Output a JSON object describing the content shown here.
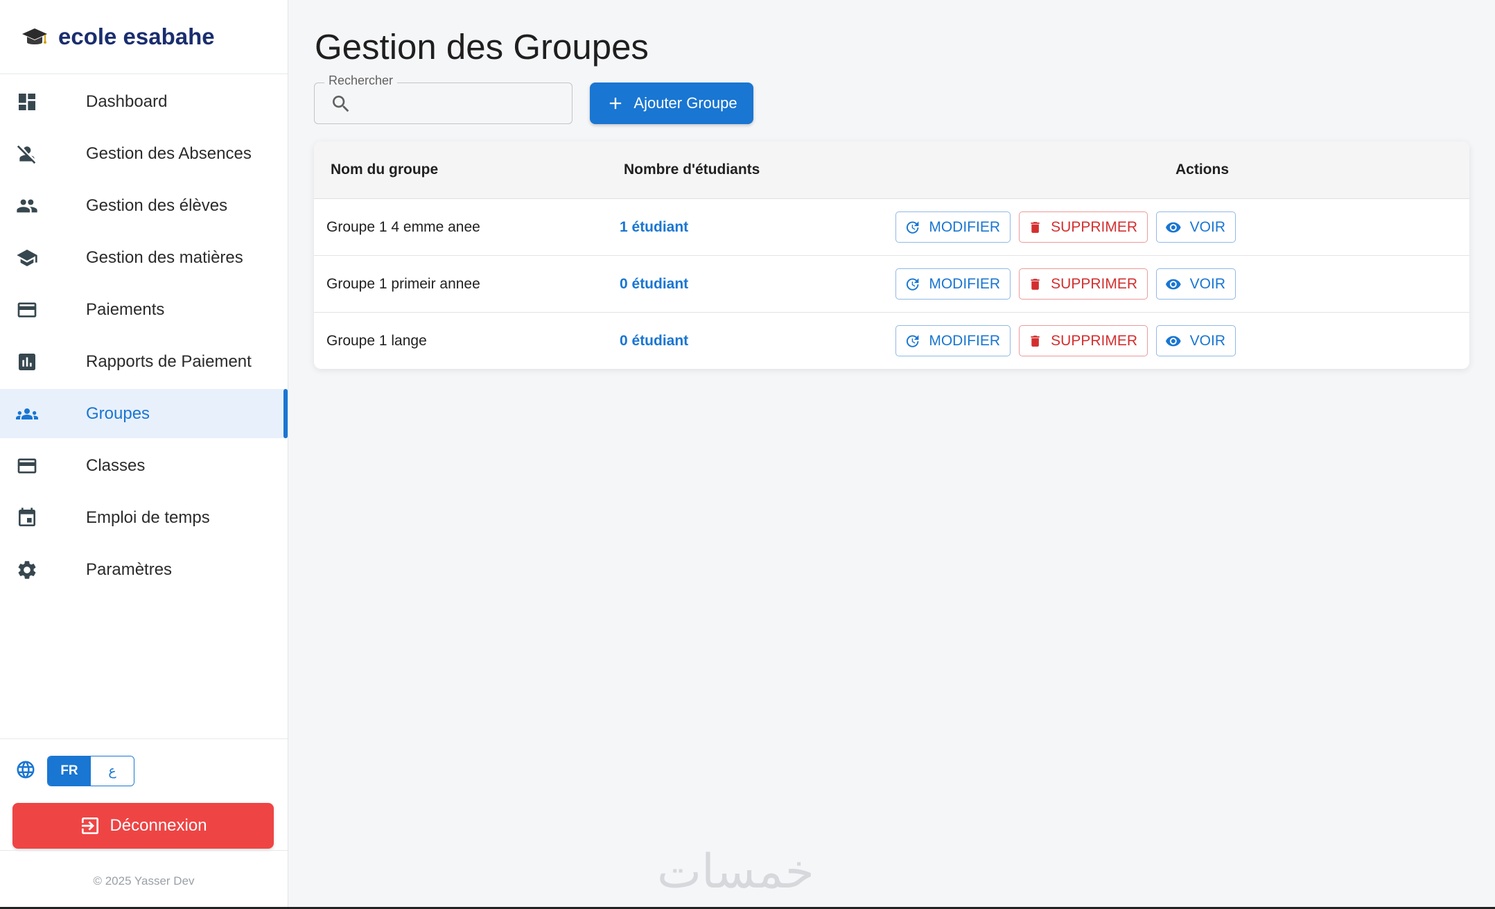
{
  "brand": {
    "name": "ecole esabahe",
    "icon": "graduation-cap-icon"
  },
  "sidebar": {
    "items": [
      {
        "label": "Dashboard",
        "icon": "dashboard-icon"
      },
      {
        "label": "Gestion des Absences",
        "icon": "person-off-icon"
      },
      {
        "label": "Gestion des élèves",
        "icon": "people-icon"
      },
      {
        "label": "Gestion des matières",
        "icon": "school-icon"
      },
      {
        "label": "Paiements",
        "icon": "credit-card-icon"
      },
      {
        "label": "Rapports de Paiement",
        "icon": "bar-chart-icon"
      },
      {
        "label": "Groupes",
        "icon": "groups-icon",
        "active": true
      },
      {
        "label": "Classes",
        "icon": "card-icon"
      },
      {
        "label": "Emploi de temps",
        "icon": "calendar-icon"
      },
      {
        "label": "Paramètres",
        "icon": "gear-icon"
      }
    ],
    "language": {
      "fr": "FR",
      "ar": "ع"
    },
    "logout_label": "Déconnexion",
    "copyright": "© 2025 Yasser Dev"
  },
  "main": {
    "title": "Gestion des Groupes",
    "search": {
      "label": "Rechercher",
      "value": ""
    },
    "add_label": "Ajouter Groupe",
    "table": {
      "headers": [
        "Nom du groupe",
        "Nombre d'étudiants",
        "Actions"
      ],
      "rows": [
        {
          "name": "Groupe 1 4 emme anee",
          "count": "1 étudiant"
        },
        {
          "name": "Groupe 1 primeir annee",
          "count": "0 étudiant"
        },
        {
          "name": "Groupe 1 lange",
          "count": "0 étudiant"
        }
      ],
      "actions": {
        "edit": "MODIFIER",
        "delete": "SUPPRIMER",
        "view": "VOIR"
      }
    }
  },
  "watermark": "خمسات",
  "colors": {
    "primary": "#1976d2",
    "danger": "#ef4444",
    "brand": "#1a2e6e"
  }
}
